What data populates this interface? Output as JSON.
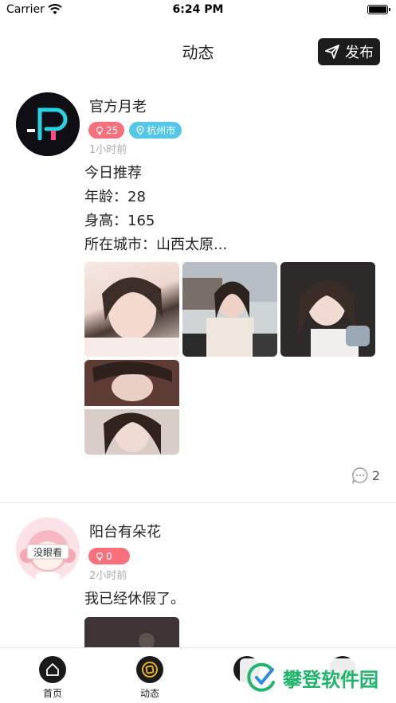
{
  "status_bar": {
    "carrier": "Carrier",
    "time": "6:24 PM"
  },
  "nav": {
    "title": "动态",
    "publish_label": "发布"
  },
  "posts": [
    {
      "user": "官方月老",
      "tags": {
        "likes": "25",
        "city": "杭州市"
      },
      "time": "1小时前",
      "lines": [
        "今日推荐",
        "年龄：28",
        "身高：165",
        "所在城市：山西太原..."
      ],
      "comments": "2"
    },
    {
      "user": "阳台有朵花",
      "avatar_text": "没眼看",
      "tags": {
        "likes": "0"
      },
      "time": "2小时前",
      "lines": [
        "我已经休假了。"
      ]
    }
  ],
  "tabs": [
    {
      "label": "首页"
    },
    {
      "label": "动态"
    }
  ],
  "watermark": "攀登软件园",
  "colors": {
    "tag_pink": "#f8707c",
    "tag_blue": "#52c8e6",
    "tab_active": "#e3b21c",
    "watermark_green": "#1fb56b"
  }
}
